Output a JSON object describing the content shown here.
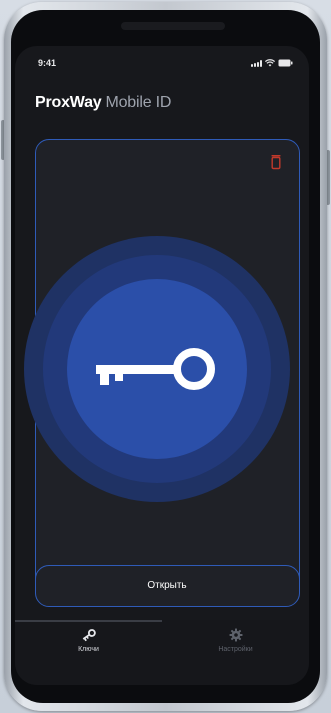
{
  "status_bar": {
    "time": "9:41",
    "icons": [
      "signal-icon",
      "wifi-icon",
      "battery-icon"
    ]
  },
  "header": {
    "brand": "ProxWay",
    "product": "Mobile ID"
  },
  "key_card": {
    "delete_icon": "trash-icon",
    "key_icon": "key-icon",
    "open_label": "Открыть"
  },
  "tab_bar": {
    "tabs": [
      {
        "label": "Ключи",
        "icon": "key-icon",
        "active": true
      },
      {
        "label": "Настройки",
        "icon": "gear-icon",
        "active": false
      }
    ]
  },
  "colors": {
    "accent": "#2f5bb8",
    "ring_outer": "#1f3264",
    "ring_middle": "#22397a",
    "ring_inner": "#2b4fa9",
    "delete": "#c0392b",
    "background": "#17181c"
  }
}
